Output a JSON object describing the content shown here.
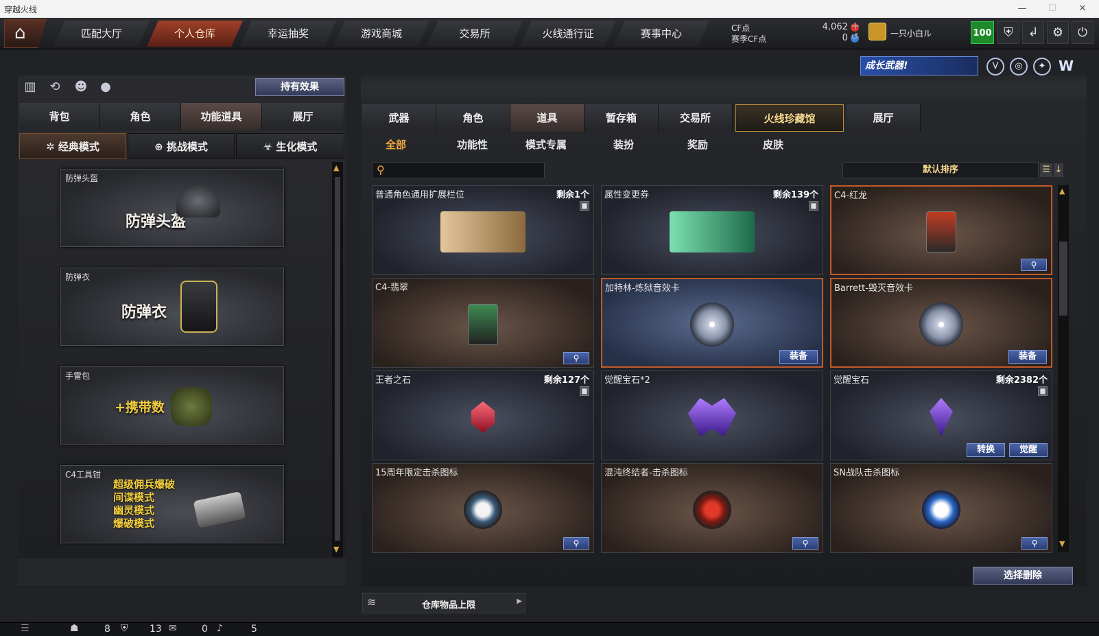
{
  "window": {
    "title": "穿越火线"
  },
  "topnav": {
    "tabs": [
      {
        "label": "匹配大厅"
      },
      {
        "label": "个人仓库"
      },
      {
        "label": "幸运抽奖"
      },
      {
        "label": "游戏商城"
      },
      {
        "label": "交易所"
      },
      {
        "label": "火线通行证"
      },
      {
        "label": "赛事中心"
      }
    ],
    "active_tab": "个人仓库",
    "cf_label": "CF点",
    "cf_value": "4,062",
    "season_cf_label": "赛季CF点",
    "season_cf_value": "0",
    "player_name": "一只小白ル",
    "level": "100"
  },
  "banner": {
    "text": "成长武器!"
  },
  "left": {
    "effect_button": "持有效果",
    "tabs": [
      "背包",
      "角色",
      "功能道具",
      "展厅"
    ],
    "active_tab": "功能道具",
    "modes": [
      "经典模式",
      "挑战模式",
      "生化模式"
    ],
    "active_mode": "经典模式",
    "cards": [
      {
        "label": "防弹头盔",
        "text": "防弹头盔"
      },
      {
        "label": "防弹衣",
        "text": "防弹衣"
      },
      {
        "label": "手雷包",
        "text": "+携带数"
      },
      {
        "label": "C4工具钳",
        "lines": [
          "超级佣兵爆破",
          "间谍模式",
          "幽灵模式",
          "爆破模式"
        ]
      }
    ]
  },
  "right": {
    "tabs": [
      "武器",
      "角色",
      "道具",
      "暂存箱",
      "交易所",
      "火线珍藏馆",
      "展厅"
    ],
    "active_tab": "道具",
    "highlight_tab": "火线珍藏馆",
    "subtabs": [
      "全部",
      "功能性",
      "模式专属",
      "装扮",
      "奖励",
      "皮肤"
    ],
    "active_subtab": "全部",
    "search_placeholder": "",
    "sort_label": "默认排序",
    "items": [
      {
        "name": "普通角色通用扩展栏位",
        "remain": "剩余1个"
      },
      {
        "name": "属性变更券",
        "remain": "剩余139个"
      },
      {
        "name": "C4-红龙",
        "remain": ""
      },
      {
        "name": "C4-翡翠",
        "remain": ""
      },
      {
        "name": "加特林-炼狱音效卡",
        "remain": "",
        "button": "装备"
      },
      {
        "name": "Barrett-毁灭音效卡",
        "remain": "",
        "button": "装备"
      },
      {
        "name": "王者之石",
        "remain": "剩余127个"
      },
      {
        "name": "觉醒宝石*2",
        "remain": ""
      },
      {
        "name": "觉醒宝石",
        "remain": "剩余2382个",
        "button1": "转换",
        "button2": "觉醒"
      },
      {
        "name": "15周年限定击杀图标",
        "remain": ""
      },
      {
        "name": "混沌终结者-击杀图标",
        "remain": ""
      },
      {
        "name": "SN战队击杀图标",
        "remain": ""
      }
    ],
    "delete_button": "选择删除",
    "capacity_label": "仓库物品上限"
  },
  "statusbar": {
    "friends": "8",
    "guild": "13",
    "messages": "0",
    "volume": "5"
  }
}
